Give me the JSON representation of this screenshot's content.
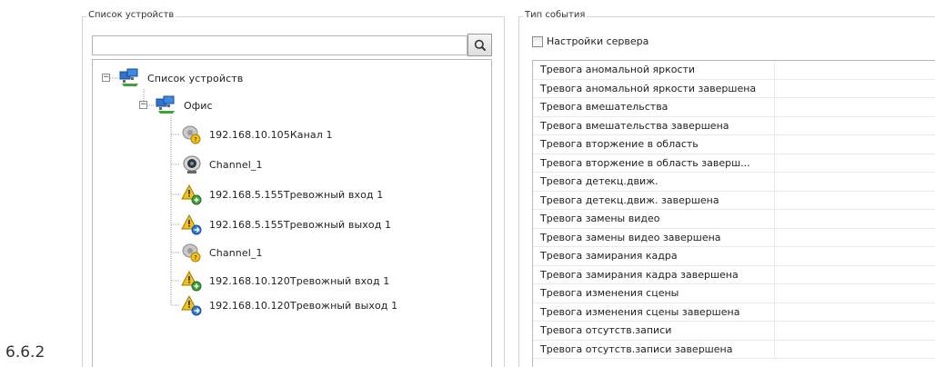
{
  "section_number": "6.6.2",
  "devices": {
    "group_title": "Список устройств",
    "search": {
      "value": "",
      "placeholder": ""
    },
    "tree": [
      {
        "label": "Список устройств",
        "icon": "network-group-icon",
        "level": 0
      },
      {
        "label": "Офис",
        "icon": "network-group-icon",
        "level": 1
      },
      {
        "label": "192.168.10.105Канал 1",
        "icon": "camera-warning-icon",
        "level": 2
      },
      {
        "label": "Channel_1",
        "icon": "webcam-icon",
        "level": 2
      },
      {
        "label": "192.168.5.155Тревожный вход 1",
        "icon": "alarm-input-icon",
        "level": 2
      },
      {
        "label": "192.168.5.155Тревожный выход 1",
        "icon": "alarm-output-icon",
        "level": 2
      },
      {
        "label": "Channel_1",
        "icon": "camera-warning-icon",
        "level": 2
      },
      {
        "label": "192.168.10.120Тревожный вход 1",
        "icon": "alarm-input-icon",
        "level": 2
      },
      {
        "label": "192.168.10.120Тревожный выход 1",
        "icon": "alarm-output-icon",
        "level": 2
      }
    ]
  },
  "events": {
    "group_title": "Тип события",
    "server_settings_label": "Настройки сервера",
    "server_settings_checked": false,
    "items": [
      "Тревога аномальной яркости",
      "Тревога аномальной яркости завершена",
      "Тревога вмешательства",
      "Тревога вмешательства завершена",
      "Тревога вторжение в область",
      "Тревога вторжение в область заверш...",
      "Тревога детекц.движ.",
      "Тревога детекц.движ. завершена",
      "Тревога замены видео",
      "Тревога замены видео завершена",
      "Тревога замирания кадра",
      "Тревога замирания кадра завершена",
      "Тревога изменения сцены",
      "Тревога изменения сцены завершена",
      "Тревога отсутств.записи",
      "Тревога отсутств.записи завершена"
    ]
  }
}
